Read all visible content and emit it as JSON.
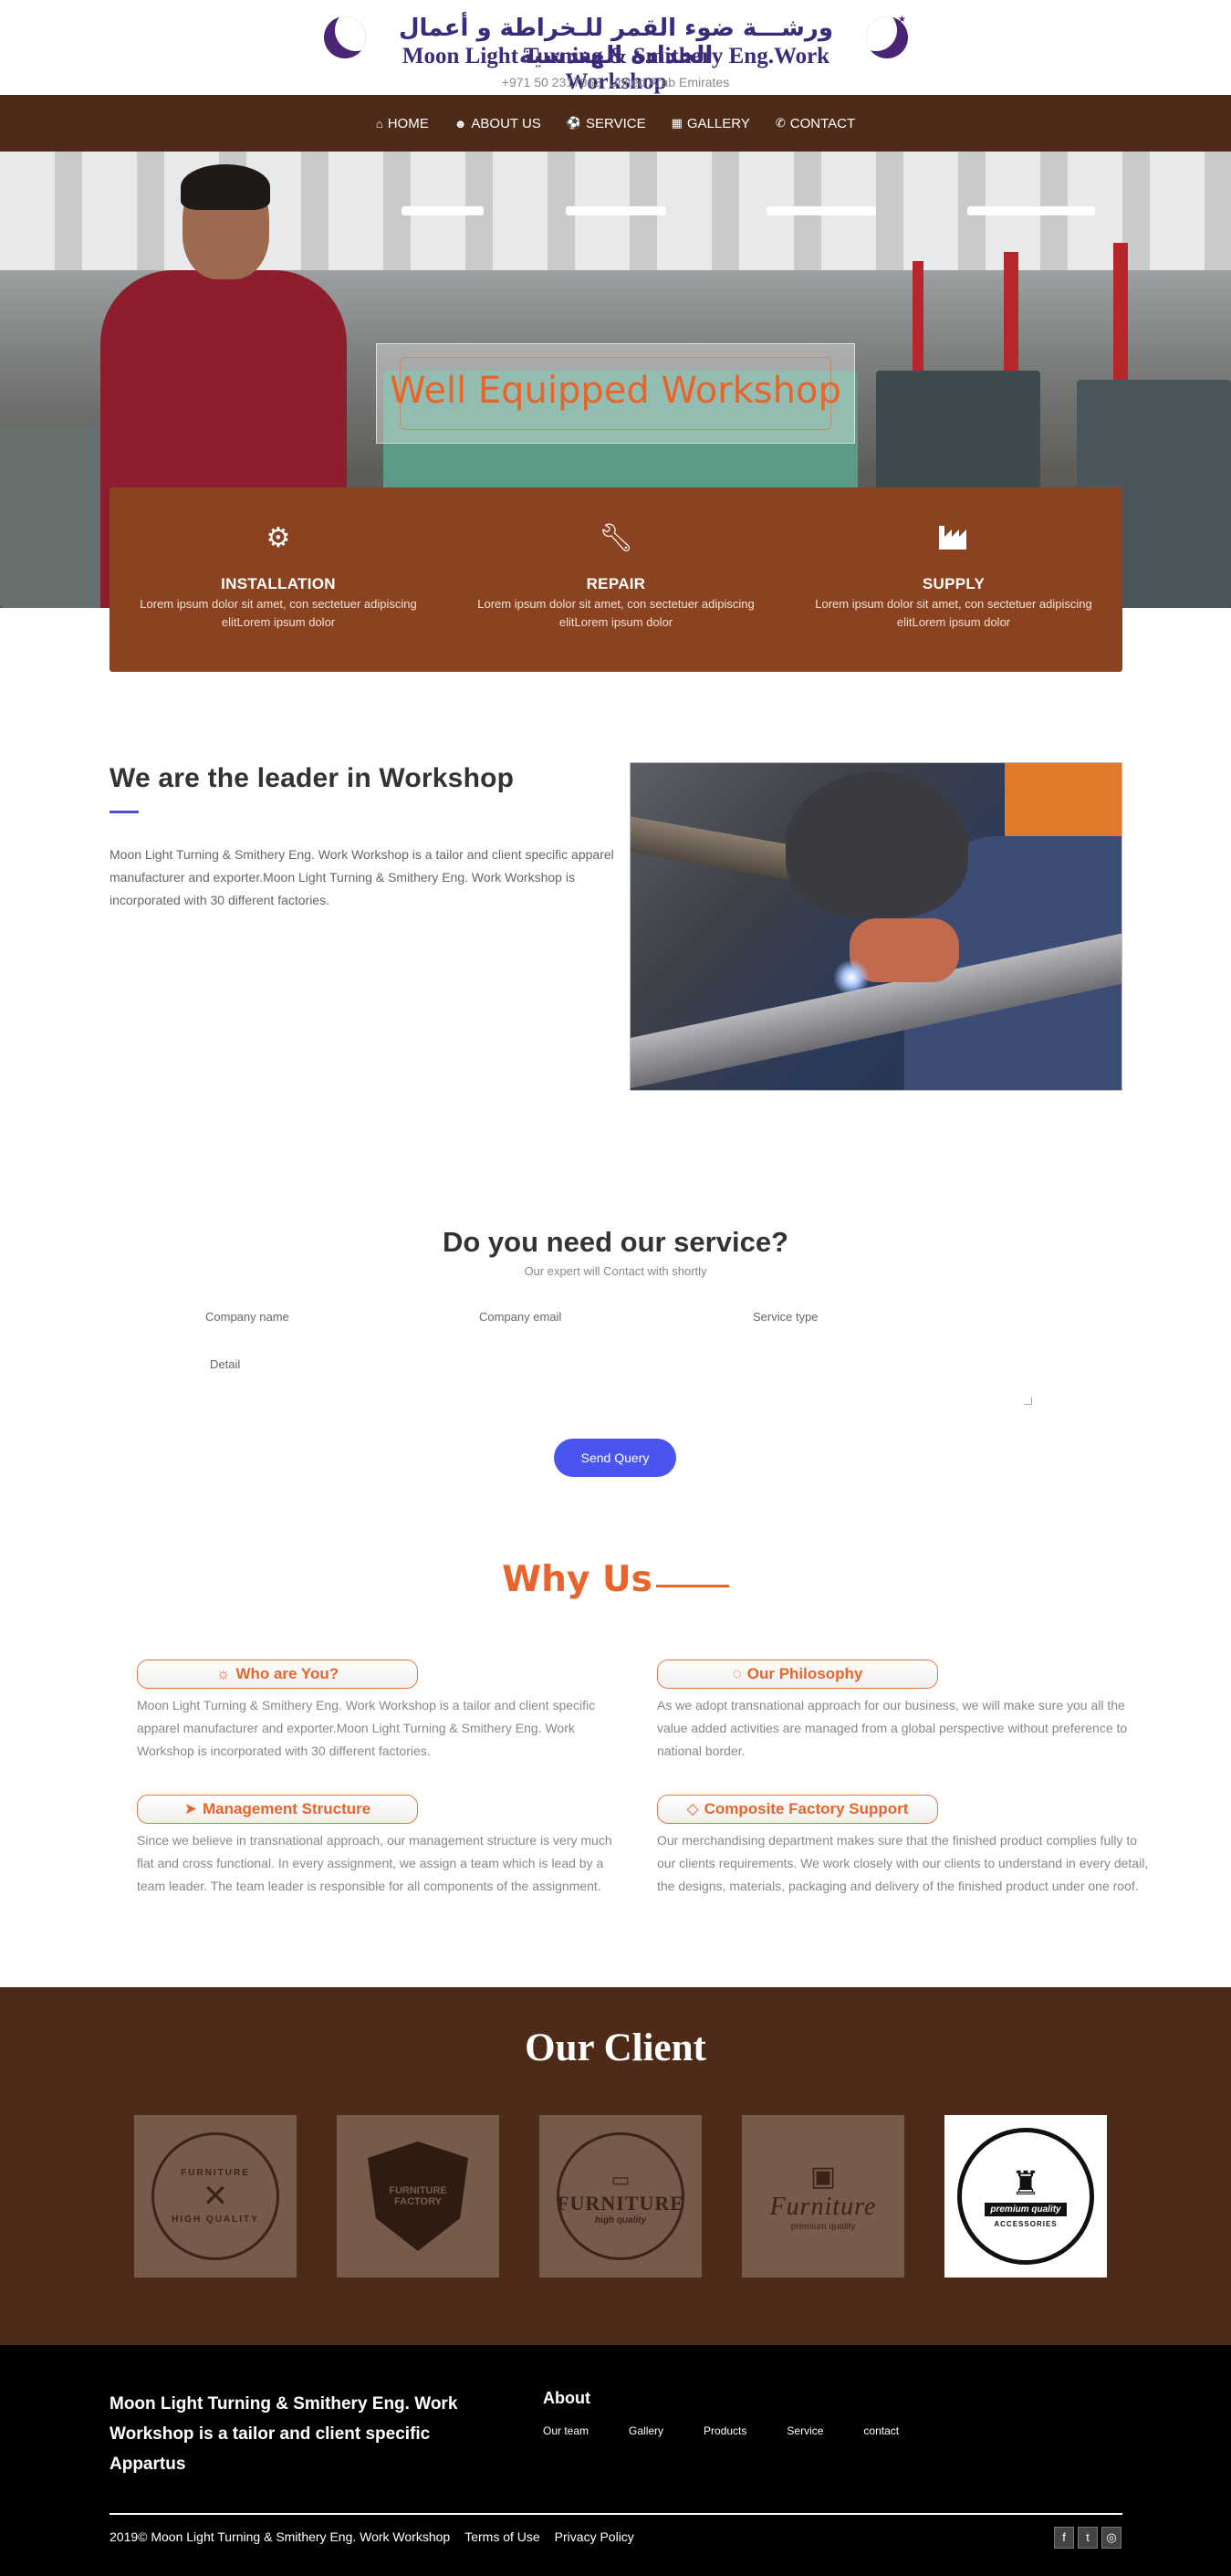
{
  "header": {
    "arabic_name": "ورشـــة ضوء القمر للـخراطة و أعمال الحدادة الهندسية",
    "brand": "Moon Light Turning & Smithery Eng.Work Workshop",
    "contact_line": "+971 50 2317963, United Arab Emirates"
  },
  "nav": {
    "items": [
      {
        "label": "HOME",
        "icon": "home-icon"
      },
      {
        "label": "ABOUT US",
        "icon": "user-icon"
      },
      {
        "label": "SERVICE",
        "icon": "soccer-ball-icon"
      },
      {
        "label": "GALLERY",
        "icon": "film-icon"
      },
      {
        "label": "CONTACT",
        "icon": "phone-icon"
      }
    ]
  },
  "hero": {
    "title": "Well Equipped Workshop"
  },
  "services": [
    {
      "icon": "gear-icon",
      "title": "INSTALLATION",
      "text": "Lorem ipsum dolor sit amet, con sectetuer adipiscing elitLorem ipsum dolor"
    },
    {
      "icon": "wrench-icon",
      "title": "REPAIR",
      "text": "Lorem ipsum dolor sit amet, con sectetuer adipiscing elitLorem ipsum dolor"
    },
    {
      "icon": "factory-icon",
      "title": "SUPPLY",
      "text": "Lorem ipsum dolor sit amet, con sectetuer adipiscing elitLorem ipsum dolor"
    }
  ],
  "about": {
    "title": "We are the leader in Workshop",
    "text": "Moon Light Turning & Smithery Eng. Work Workshop is a tailor and client specific apparel manufacturer and exporter.Moon Light Turning & Smithery Eng. Work Workshop is incorporated with 30 different factories."
  },
  "form": {
    "title": "Do you need our service?",
    "subtitle": "Our expert will Contact with shortly",
    "company_name_placeholder": "Company name",
    "company_email_placeholder": "Company email",
    "service_type_placeholder": "Service type",
    "detail_placeholder": "Detail",
    "submit_label": "Send Query"
  },
  "why": {
    "title": "Why Us",
    "items": [
      {
        "icon": "sun-icon",
        "title": "Who are You?",
        "text": "Moon Light Turning & Smithery Eng. Work Workshop is a tailor and client specific apparel manufacturer and exporter.Moon Light Turning & Smithery Eng. Work Workshop is incorporated with 30 different factories."
      },
      {
        "icon": "circle-notch-icon",
        "title": "Our Philosophy",
        "text": "As we adopt transnational approach for our business, we will make sure you all the value added activities are managed from a global perspective without preference to national border."
      },
      {
        "icon": "location-arrow-icon",
        "title": "Management Structure",
        "text": "Since we believe in transnational approach, our management structure is very much flat and cross functional. In every assignment, we assign a team which is lead by a team leader. The team leader is responsible for all components of the assignment."
      },
      {
        "icon": "diamond-icon",
        "title": "Composite Factory Support",
        "text": "Our merchandising department makes sure that the finished product complies fully to our clients requirements. We work closely with our clients to understand in every detail, the designs, materials, packaging and delivery of the finished product under one roof."
      }
    ]
  },
  "clients": {
    "title": "Our Client",
    "logos": [
      {
        "top": "FURNITURE",
        "bottom": "HIGH QUALITY"
      },
      {
        "top": "",
        "bottom": "FURNITURE FACTORY"
      },
      {
        "top": "FURNITURE",
        "bottom": "high quality"
      },
      {
        "top": "Furniture",
        "bottom": "premium quality"
      },
      {
        "top": "premium quality",
        "bottom": "ACCESSORIES"
      }
    ]
  },
  "footer": {
    "tagline": "Moon Light Turning & Smithery Eng. Work Workshop is a tailor and client specific Appartus",
    "about_title": "About",
    "links": [
      "Our team",
      "Gallery",
      "Products",
      "Service",
      "contact"
    ],
    "copyright": "2019© Moon Light Turning & Smithery Eng. Work Workshop",
    "terms": "Terms of Use",
    "privacy": "Privacy Policy",
    "social": [
      {
        "icon": "facebook-icon",
        "glyph": "f"
      },
      {
        "icon": "twitter-icon",
        "glyph": "t"
      },
      {
        "icon": "instagram-icon",
        "glyph": "◎"
      }
    ]
  },
  "colors": {
    "nav_bg": "#4d2b18",
    "services_bg": "#8a4220",
    "accent_orange": "#e8642a",
    "button_blue": "#4a55f0",
    "brand_purple": "#3c2a7a"
  }
}
